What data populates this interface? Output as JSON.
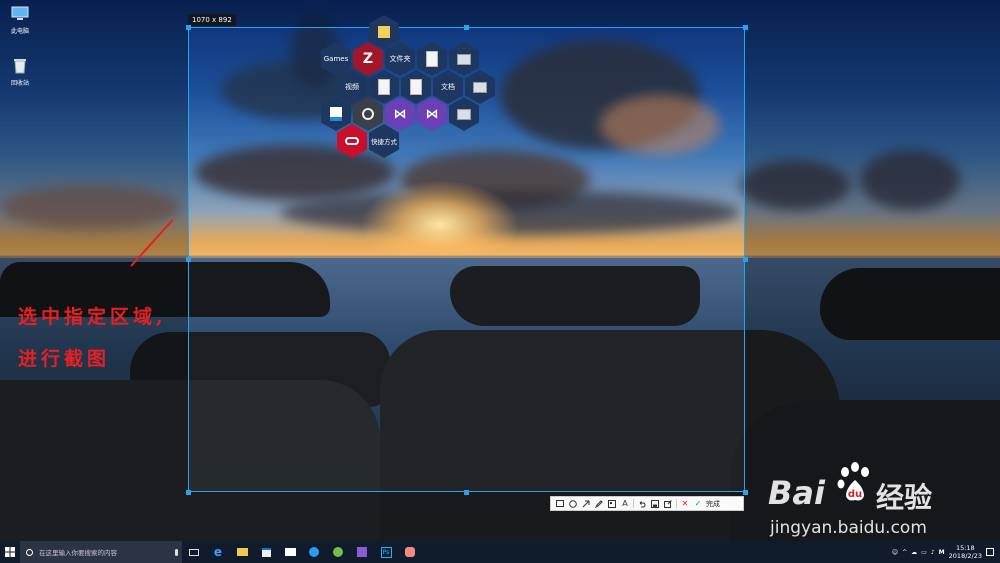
{
  "desktop": {
    "icons": [
      {
        "label": "此电脑",
        "icon": "computer-icon"
      },
      {
        "label": "回收站",
        "icon": "recycle-bin-icon"
      }
    ]
  },
  "capture": {
    "size_label": "1070 x 892",
    "toolbar": {
      "done_label": "完成",
      "tools": [
        "rectangle-icon",
        "ellipse-icon",
        "arrow-icon",
        "pen-icon",
        "mosaic-icon",
        "text-icon",
        "undo-icon",
        "save-icon",
        "pin-icon",
        "cancel-icon",
        "confirm-icon"
      ]
    }
  },
  "launcher": {
    "labels": {
      "games": "Games",
      "folder": "文件夹",
      "video": "视频",
      "documents": "文档",
      "shortcut": "快捷方式"
    },
    "colors": {
      "hex_dark": "#1d3760",
      "hex_edge": "#2f5588",
      "adobe": "#c8102e",
      "vs": "#6b3fb5"
    }
  },
  "annotation": {
    "line1": "选中指定区域,",
    "line2": "进行截图",
    "color": "#e62020"
  },
  "watermark": {
    "brand": "Bai",
    "brand_cn": "经验",
    "url": "jingyan.baidu.com"
  },
  "taskbar": {
    "search_placeholder": "在这里输入你要搜索的内容",
    "time": "15:18",
    "date": "2018/2/23",
    "ime": "M"
  }
}
